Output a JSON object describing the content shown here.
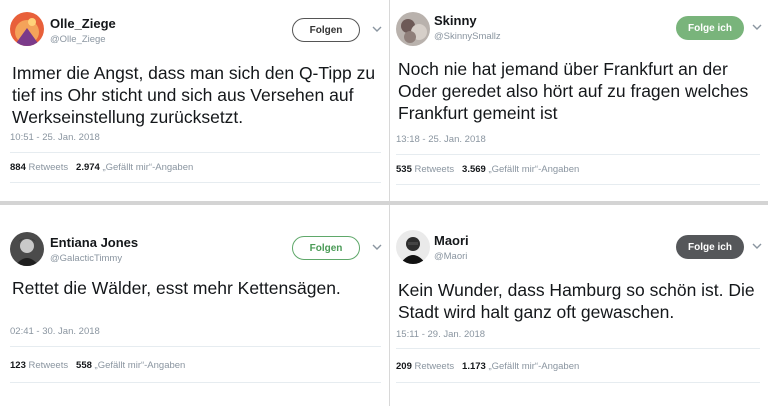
{
  "tweets": [
    {
      "name": "Olle_Ziege",
      "handle": "@Olle_Ziege",
      "button": "Folgen",
      "text": "Immer die Angst, dass man sich den Q-Tipp zu tief ins Ohr sticht und sich aus Versehen auf Werkseinstellung zurücksetzt.",
      "time": "10:51 - 25. Jan. 2018",
      "retweets": "884",
      "retweets_label": "Retweets",
      "likes": "2.974",
      "likes_label": "„Gefällt mir“-Angaben"
    },
    {
      "name": "Skinny",
      "handle": "@SkinnySmallz",
      "button": "Folge ich",
      "text": "Noch nie hat jemand über Frankfurt an der Oder geredet also hört auf zu fragen welches Frankfurt gemeint ist",
      "time": "13:18 - 25. Jan. 2018",
      "retweets": "535",
      "retweets_label": "Retweets",
      "likes": "3.569",
      "likes_label": "„Gefällt mir“-Angaben"
    },
    {
      "name": "Entiana Jones",
      "handle": "@GalacticTimmy",
      "button": "Folgen",
      "text": "Rettet die Wälder, esst mehr Kettensägen.",
      "time": "02:41 - 30. Jan. 2018",
      "retweets": "123",
      "retweets_label": "Retweets",
      "likes": "558",
      "likes_label": "„Gefällt mir“-Angaben"
    },
    {
      "name": "Maori",
      "handle": "@Maori",
      "button": "Folge ich",
      "text": "Kein Wunder, dass Hamburg so schön ist. Die Stadt wird halt ganz oft gewaschen.",
      "time": "15:11 - 29. Jan. 2018",
      "retweets": "209",
      "retweets_label": "Retweets",
      "likes": "1.173",
      "likes_label": "„Gefällt mir“-Angaben"
    }
  ],
  "colors": {
    "following_green": "#79b47b",
    "following_dark": "#55575a",
    "follow_green_outline": "#5fa86a",
    "meta_gray": "#8a95a0"
  },
  "icons": {
    "more": "chevron-down-icon",
    "avatar": "user-avatar"
  }
}
